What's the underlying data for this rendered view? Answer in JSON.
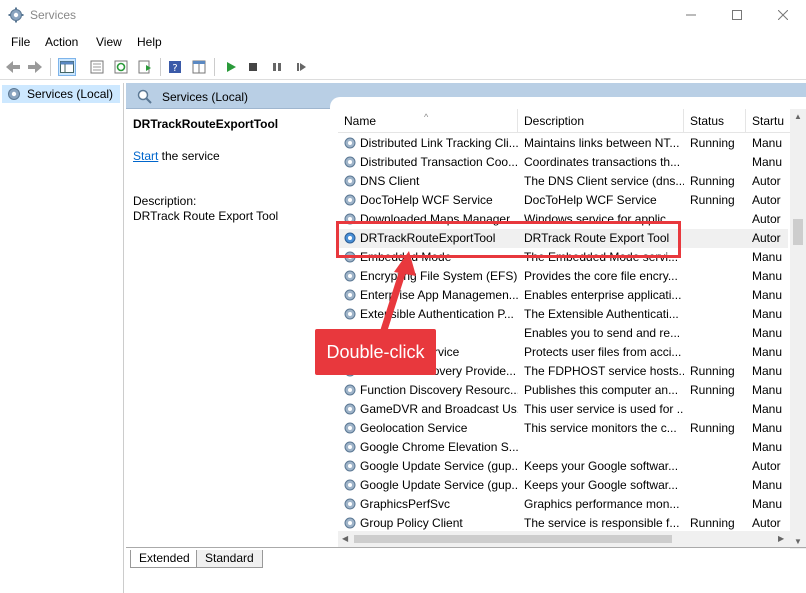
{
  "window": {
    "title": "Services"
  },
  "menu": [
    "File",
    "Action",
    "View",
    "Help"
  ],
  "tree": {
    "selected_label": "Services (Local)"
  },
  "pane": {
    "header_title": "Services (Local)",
    "service_name": "DRTrackRouteExportTool",
    "start_link": "Start",
    "start_suffix": " the service",
    "description_label": "Description:",
    "description_text": "DRTrack Route Export Tool"
  },
  "columns": [
    "Name",
    "Description",
    "Status",
    "Startu"
  ],
  "rows": [
    {
      "name": "Distributed Link Tracking Cli...",
      "description": "Maintains links between NT...",
      "status": "Running",
      "startup": "Manu"
    },
    {
      "name": "Distributed Transaction Coo...",
      "description": "Coordinates transactions th...",
      "status": "",
      "startup": "Manu"
    },
    {
      "name": "DNS Client",
      "description": "The DNS Client service (dns...",
      "status": "Running",
      "startup": "Autor"
    },
    {
      "name": "DocToHelp WCF Service",
      "description": "DocToHelp WCF Service",
      "status": "Running",
      "startup": "Autor"
    },
    {
      "name": "Downloaded Maps Manager",
      "description": "Windows service for applic...",
      "status": "",
      "startup": "Autor"
    },
    {
      "name": "DRTrackRouteExportTool",
      "description": "DRTrack Route Export Tool",
      "status": "",
      "startup": "Autor"
    },
    {
      "name": "Embedded Mode",
      "description": "The Embedded Mode servi...",
      "status": "",
      "startup": "Manu"
    },
    {
      "name": "Encrypting File System (EFS)",
      "description": "Provides the core file encry...",
      "status": "",
      "startup": "Manu"
    },
    {
      "name": "Enterprise App Managemen...",
      "description": "Enables enterprise applicati...",
      "status": "",
      "startup": "Manu"
    },
    {
      "name": "Extensible Authentication P...",
      "description": "The Extensible Authenticati...",
      "status": "",
      "startup": "Manu"
    },
    {
      "name": "",
      "description": "Enables you to send and re...",
      "status": "",
      "startup": "Manu"
    },
    {
      "name": "rvice",
      "description": "Protects user files from acci...",
      "status": "",
      "startup": "Manu"
    },
    {
      "name": "Function Discovery Provide...",
      "description": "The FDPHOST service hosts...",
      "status": "Running",
      "startup": "Manu"
    },
    {
      "name": "Function Discovery Resourc...",
      "description": "Publishes this computer an...",
      "status": "Running",
      "startup": "Manu"
    },
    {
      "name": "GameDVR and Broadcast Us...",
      "description": "This user service is used for ...",
      "status": "",
      "startup": "Manu"
    },
    {
      "name": "Geolocation Service",
      "description": "This service monitors the c...",
      "status": "Running",
      "startup": "Manu"
    },
    {
      "name": "Google Chrome Elevation S...",
      "description": "",
      "status": "",
      "startup": "Manu"
    },
    {
      "name": "Google Update Service (gup...",
      "description": "Keeps your Google softwar...",
      "status": "",
      "startup": "Autor"
    },
    {
      "name": "Google Update Service (gup...",
      "description": "Keeps your Google softwar...",
      "status": "",
      "startup": "Manu"
    },
    {
      "name": "GraphicsPerfSvc",
      "description": "Graphics performance mon...",
      "status": "",
      "startup": "Manu"
    },
    {
      "name": "Group Policy Client",
      "description": "The service is responsible f...",
      "status": "Running",
      "startup": "Autor"
    }
  ],
  "tabs": [
    "Extended",
    "Standard"
  ],
  "annotation": {
    "callout_text": "Double-click"
  },
  "colors": {
    "accent_red": "#e8383d",
    "header_blue": "#b9cfe5",
    "selection": "#cde8ff",
    "link": "#0066cc"
  }
}
